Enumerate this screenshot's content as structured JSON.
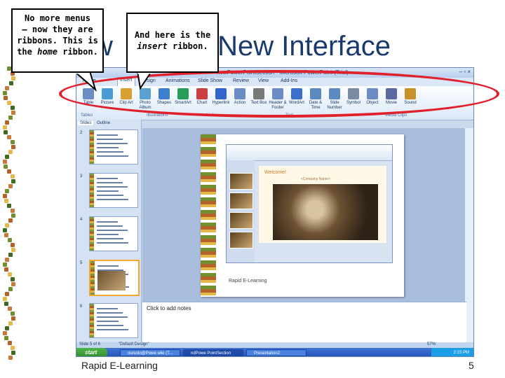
{
  "slide": {
    "title_visible": "w",
    "title_right": "’s New Interface",
    "footer_left": "Rapid E-Learning",
    "page_number": "5"
  },
  "callouts": {
    "home": {
      "line1": "No more menus",
      "line2": "– now they are",
      "line3": "ribbons. This is",
      "line4_a": "the ",
      "line4_italic": "home",
      "line4_b": " ribbon."
    },
    "insert": {
      "line1": "And here is the",
      "line2_italic": "insert",
      "line2_b": " ribbon."
    }
  },
  "ppt": {
    "window_title": "newPowerPointSection - Microsoft PowerPoint (Trial)",
    "tabs": [
      "Home",
      "Insert",
      "Design",
      "Animations",
      "Slide Show",
      "Review",
      "View",
      "Add-Ins"
    ],
    "active_tab": "Insert",
    "ribbon_buttons": [
      "Table",
      "Picture",
      "Clip Art",
      "Photo Album",
      "Shapes",
      "SmartArt",
      "Chart",
      "Hyperlink",
      "Action",
      "Text Box",
      "Header & Footer",
      "WordArt",
      "Date & Time",
      "Slide Number",
      "Symbol",
      "Object",
      "Movie",
      "Sound"
    ],
    "groups": [
      "Tables",
      "Illustrations",
      "Links",
      "Text",
      "Media Clips"
    ],
    "panel_tabs": [
      "Slides",
      "Outline"
    ],
    "thumb_numbers": [
      "2",
      "3",
      "4",
      "5",
      "6"
    ],
    "inner_welcome": "Welcome!",
    "inner_company": "<Company Name>",
    "inner_rapid": "Rapid E-Learning",
    "notes_placeholder": "Click to add notes",
    "status_left": "Slide 5 of 6",
    "status_theme": "\"Default Design\"",
    "zoom": "57%",
    "taskbar_start": "start",
    "taskbar_items": [
      "ouncdo@Powe wiki (T...",
      "ndPowe PointSection",
      "Presentation2"
    ],
    "clock": "2:23 PM"
  }
}
